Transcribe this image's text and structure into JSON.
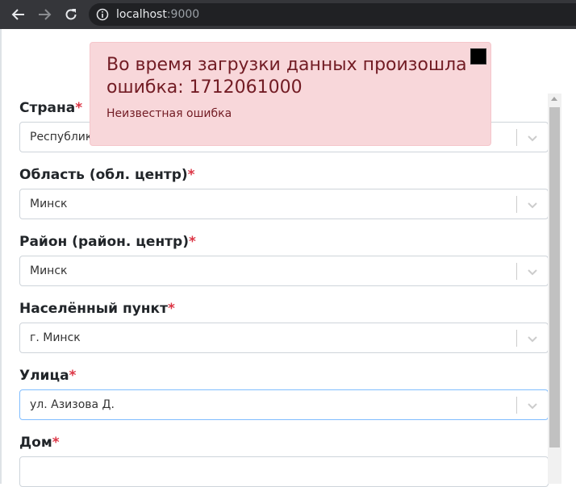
{
  "browser": {
    "host": "localhost",
    "port": ":9000"
  },
  "form": {
    "country": {
      "label": "Страна",
      "value": "Республика Беларусь"
    },
    "region": {
      "label": "Область (обл. центр)",
      "value": "Минск"
    },
    "district": {
      "label": "Район (район. центр)",
      "value": "Минск"
    },
    "locality": {
      "label": "Населённый пункт",
      "value": "г. Минск"
    },
    "street": {
      "label": "Улица",
      "value": "ул. Азизова Д."
    },
    "house": {
      "label": "Дом",
      "value": ""
    },
    "required_mark": "*"
  },
  "toast": {
    "title": "Во время загрузки данных произошла ошибка: 1712061000",
    "message": "Неизвестная ошибка"
  },
  "colors": {
    "required": "#dc3545",
    "toast_bg": "#f8d7da",
    "toast_text": "#721c24"
  },
  "icons": {
    "back": "arrow-left-icon",
    "forward": "arrow-right-icon",
    "reload": "reload-icon",
    "info": "info-icon",
    "chevron": "chevron-down-icon",
    "close": "close-icon"
  }
}
